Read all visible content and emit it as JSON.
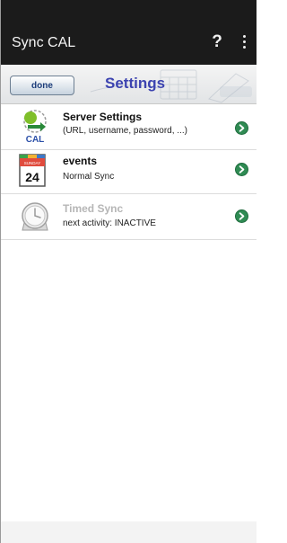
{
  "app_bar": {
    "title": "Sync CAL",
    "help_label": "?",
    "overflow_icon": "more-vert-icon"
  },
  "settings_header": {
    "done_label": "done",
    "title": "Settings"
  },
  "rows": [
    {
      "title": "Server Settings",
      "subtitle": "(URL, username, password, ...)",
      "icon": "server-sync-icon",
      "icon_text": "CAL",
      "enabled": true
    },
    {
      "title": "events",
      "subtitle": "Normal Sync",
      "icon": "calendar-icon",
      "icon_day": "24",
      "icon_weekday": "SUNDAY",
      "enabled": true
    },
    {
      "title": "Timed Sync",
      "subtitle": "next activity:  INACTIVE",
      "icon": "clock-icon",
      "enabled": false
    }
  ],
  "colors": {
    "app_bar": "#1b1b1b",
    "settings_title": "#3c43b0",
    "chevron": "#2f8b53",
    "disabled_text": "#b6b6b6"
  }
}
